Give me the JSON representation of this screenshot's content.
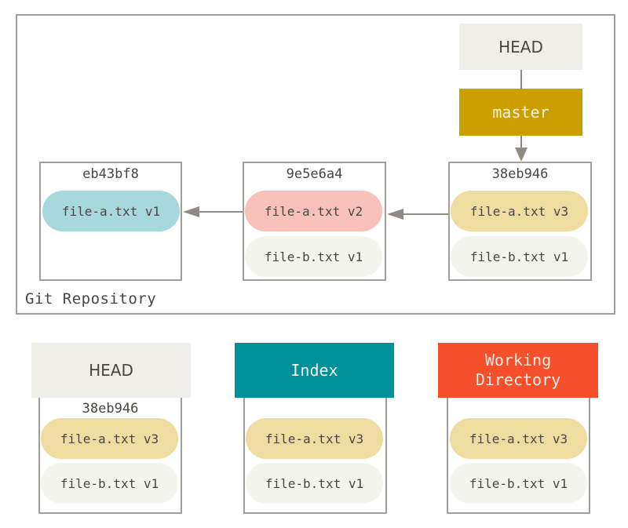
{
  "repository": {
    "label": "Git Repository",
    "head_ref": "HEAD",
    "branch_ref": "master",
    "commits": [
      {
        "hash": "eb43bf8",
        "files": [
          {
            "name": "file-a.txt v1",
            "color": "#a7d8dc"
          }
        ]
      },
      {
        "hash": "9e5e6a4",
        "files": [
          {
            "name": "file-a.txt v2",
            "color": "#f8c2ba"
          },
          {
            "name": "file-b.txt v1",
            "color": "#f5f5f0"
          }
        ]
      },
      {
        "hash": "38eb946",
        "files": [
          {
            "name": "file-a.txt v3",
            "color": "#eedca0"
          },
          {
            "name": "file-b.txt v1",
            "color": "#f5f5f0"
          }
        ]
      }
    ]
  },
  "trees": [
    {
      "title": "HEAD",
      "hash": "38eb946",
      "color": "#efeee8",
      "files": [
        "file-a.txt v3",
        "file-b.txt v1"
      ]
    },
    {
      "title": "Index",
      "hash": "",
      "color": "#00909a",
      "files": [
        "file-a.txt v3",
        "file-b.txt v1"
      ]
    },
    {
      "title_line1": "Working",
      "title_line2": "Directory",
      "hash": "",
      "color": "#f5502b",
      "files": [
        "file-a.txt v3",
        "file-b.txt v1"
      ]
    }
  ],
  "colors": {
    "border": "#a19f9a",
    "arrow": "#8f8a84",
    "master": "#cd9e00"
  }
}
